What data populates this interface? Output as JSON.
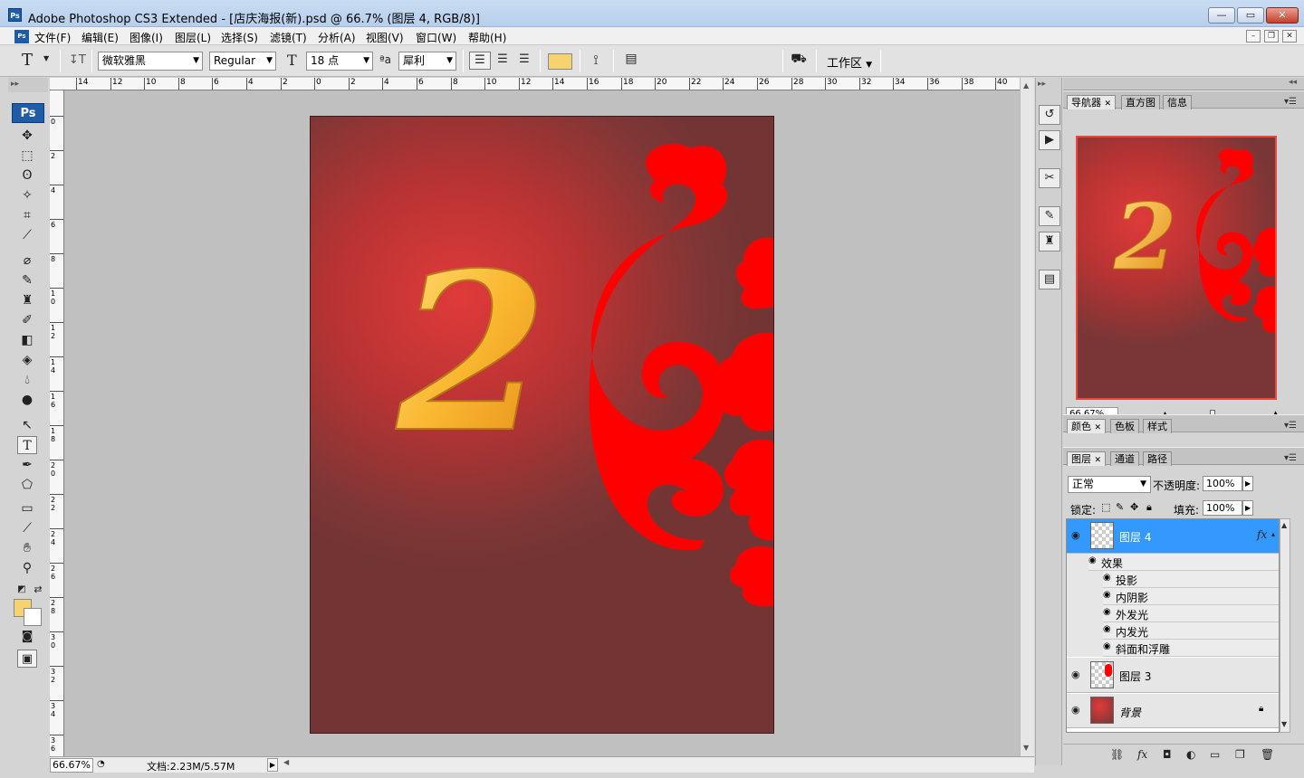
{
  "window": {
    "title": "Adobe Photoshop CS3 Extended - [店庆海报(新).psd @ 66.7% (图层 4, RGB/8)]",
    "app_badge": "Ps",
    "doc_badge": "Ps"
  },
  "menu": {
    "items": [
      "文件(F)",
      "编辑(E)",
      "图像(I)",
      "图层(L)",
      "选择(S)",
      "滤镜(T)",
      "分析(A)",
      "视图(V)",
      "窗口(W)",
      "帮助(H)"
    ]
  },
  "options": {
    "tool_glyph": "T",
    "orient_glyph": "↧T",
    "font_family": "微软雅黑",
    "font_style": "Regular",
    "size_glyph": "T",
    "font_size": "18 点",
    "aa_glyph": "ªa",
    "anti_alias": "犀利",
    "text_color": "#f6d36e",
    "workspace_label": "工作区"
  },
  "ruler": {
    "h_labels": [
      "14",
      "12",
      "10",
      "8",
      "6",
      "4",
      "2",
      "0",
      "2",
      "4",
      "6",
      "8",
      "10",
      "12",
      "14",
      "16",
      "18",
      "20",
      "22",
      "24",
      "26",
      "28",
      "30",
      "32",
      "34",
      "36",
      "38",
      "40"
    ],
    "v_labels": [
      "0",
      "2",
      "4",
      "6",
      "8",
      "10",
      "12",
      "14",
      "16",
      "18",
      "20",
      "22",
      "24",
      "26",
      "28",
      "30",
      "32",
      "34",
      "36"
    ]
  },
  "toolbox": {
    "badge": "Ps",
    "fg_color": "#f6d36e",
    "bg_color": "#ffffff"
  },
  "canvas": {
    "bg_color": "#7a3636",
    "glow_color": "#e03a3a",
    "number_text": "2",
    "number_color": "#f6b32e",
    "cloud_color": "#ff0000"
  },
  "status": {
    "zoom": "66.67%",
    "doc_info": "文档:2.23M/5.57M"
  },
  "navigator": {
    "tabs": [
      "导航器",
      "直方图",
      "信息"
    ],
    "zoom": "66.67%"
  },
  "color_panel": {
    "tabs": [
      "颜色",
      "色板",
      "样式"
    ]
  },
  "layers_panel": {
    "tabs": [
      "图层",
      "通道",
      "路径"
    ],
    "blend_mode": "正常",
    "opacity_label": "不透明度:",
    "opacity": "100%",
    "lock_label": "锁定:",
    "fill_label": "填充:",
    "fill": "100%",
    "layers": [
      {
        "name": "图层 4",
        "fx": "fx",
        "selected": true
      },
      {
        "name": "图层 3",
        "selected": false
      },
      {
        "name": "背景",
        "selected": false
      }
    ],
    "effects_label": "效果",
    "effects": [
      "投影",
      "内阴影",
      "外发光",
      "内发光",
      "斜面和浮雕"
    ]
  }
}
